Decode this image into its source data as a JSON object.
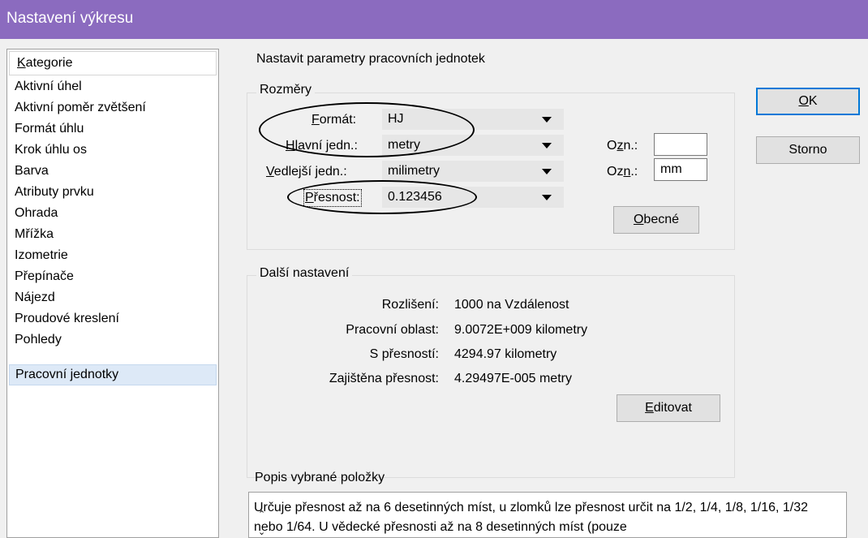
{
  "window": {
    "title": "Nastavení výkresu"
  },
  "categories": {
    "header": "Kategorie",
    "items": [
      "Aktivní úhel",
      "Aktivní poměr zvětšení",
      "Formát úhlu",
      "Krok úhlu os",
      "Barva",
      "Atributy prvku",
      "Ohrada",
      "Mřížka",
      "Izometrie",
      "Přepínače",
      "Nájezd",
      "Proudové kreslení",
      "Pohledy",
      "Pracovní jednotky"
    ],
    "selected": "Pracovní jednotky"
  },
  "main": {
    "heading": "Nastavit parametry pracovních jednotek",
    "rozmery": {
      "title": "Rozměry",
      "format_label": "Formát:",
      "format_value": "HJ",
      "hlavni_label": "Hlavní jedn.:",
      "hlavni_value": "metry",
      "vedlejsi_label": "Vedlejší jedn.:",
      "vedlejsi_value": "milimetry",
      "presnost_label": "Přesnost:",
      "presnost_value": "0.123456",
      "ozn_label": "Ozn.:",
      "ozn1_value": "",
      "ozn2_value": "mm",
      "obecne_button": "Obecné"
    },
    "dalsi": {
      "title": "Další nastavení",
      "rows": [
        {
          "label": "Rozlišení:",
          "value": "1000 na Vzdálenost"
        },
        {
          "label": "Pracovní oblast:",
          "value": "9.0072E+009 kilometry"
        },
        {
          "label": "S přesností:",
          "value": "4294.97 kilometry"
        },
        {
          "label": "Zajištěna přesnost:",
          "value": "4.29497E-005 metry"
        }
      ],
      "editovat_button": "Editovat"
    },
    "description": {
      "title": "Popis vybrané položky",
      "text": "Určuje přesnost až na 6 desetinných míst, u zlomků lze přesnost určit na 1/2, 1/4, 1/8, 1/16, 1/32 nebo 1/64. U vědecké přesnosti až na 8 desetinných míst (pouze"
    }
  },
  "buttons": {
    "ok": "OK",
    "cancel": "Storno"
  }
}
